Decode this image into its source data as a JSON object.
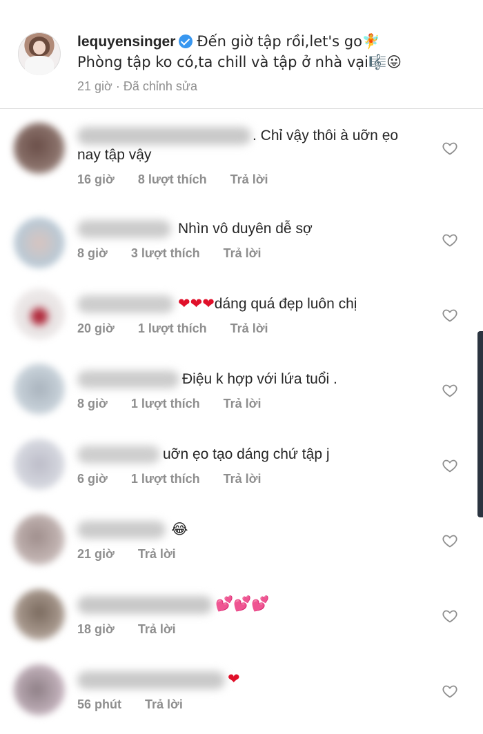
{
  "post": {
    "username": "lequyensinger",
    "caption_line1": "Đến giờ tập rồi,let's go🧚",
    "caption_line2": "Phòng tập ko có,ta chill và tập ở nhà vại🎼😛",
    "time": "21 giờ",
    "edited": "Đã chỉnh sửa",
    "separator": "·"
  },
  "comments": [
    {
      "text": ". Chỉ vậy thôi à uỡn ẹo",
      "text_line2": "nay tập vậy",
      "time": "16 giờ",
      "likes": "8 lượt thích",
      "reply": "Trả lời"
    },
    {
      "text": "Nhìn vô duyên dễ sợ",
      "time": "8 giờ",
      "likes": "3 lượt thích",
      "reply": "Trả lời"
    },
    {
      "text": "dáng quá đẹp luôn chị",
      "emoji_prefix": "❤❤❤",
      "time": "20 giờ",
      "likes": "1 lượt thích",
      "reply": "Trả lời"
    },
    {
      "text": "Điệu k hợp với lứa tuổi .",
      "time": "8 giờ",
      "likes": "1 lượt thích",
      "reply": "Trả lời"
    },
    {
      "text": "uỡn ẹo tạo dáng chứ tập j",
      "time": "6 giờ",
      "likes": "1 lượt thích",
      "reply": "Trả lời"
    },
    {
      "text": "😂",
      "time": "21 giờ",
      "reply": "Trả lời"
    },
    {
      "text": "💕💕💕",
      "time": "18 giờ",
      "reply": "Trả lời"
    },
    {
      "text": "❤",
      "time": "56 phút",
      "reply": "Trả lời"
    }
  ],
  "icons": {
    "like": "heart-outline-icon",
    "verified": "verified-badge-icon"
  },
  "colors": {
    "text": "#262626",
    "meta": "#8e8e8e",
    "verified": "#3897f0",
    "divider": "#dbdbdb"
  }
}
